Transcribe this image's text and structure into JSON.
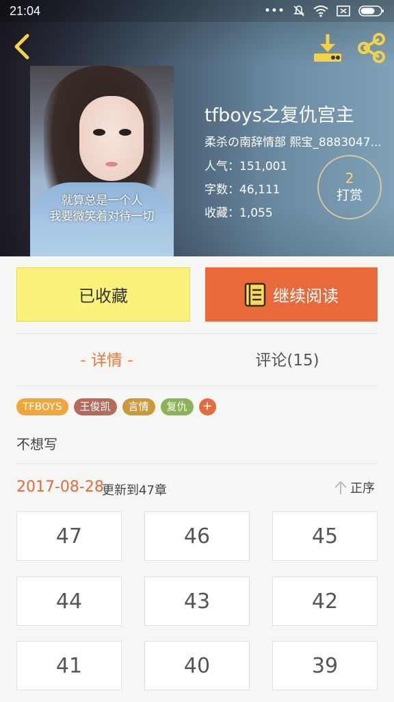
{
  "status_bar": {
    "time": "21:04",
    "dots": "•••"
  },
  "book": {
    "title": "tfboys之复仇宫主",
    "authors": "柔杀の南辞情部 熙宝_8883047...",
    "popularity": "人气：151,001",
    "word_count": "字数：46,111",
    "favorites": "收藏：1,055",
    "cover_caption_line1": "就算总是一个人",
    "cover_caption_line2": "我要微笑着对待一切"
  },
  "tip": {
    "count": "2",
    "label": "打赏"
  },
  "actions": {
    "collected_label": "已收藏",
    "continue_label": "继续阅读"
  },
  "tabs": {
    "detail": "- 详情 -",
    "comments": "评论(15)"
  },
  "tags": [
    {
      "label": "TFBOYS",
      "color": "#f0a63a"
    },
    {
      "label": "王俊凯",
      "color": "#b86a5a"
    },
    {
      "label": "言情",
      "color": "#c89a3a"
    },
    {
      "label": "复仇",
      "color": "#8cb25a"
    }
  ],
  "tag_add": "+",
  "intro": "不想写",
  "update": {
    "date": "2017-08-28",
    "text": "更新到47章",
    "sort_label": "正序"
  },
  "chapters": [
    "47",
    "46",
    "45",
    "44",
    "43",
    "42",
    "41",
    "40",
    "39"
  ],
  "colors": {
    "accent": "#e8693a",
    "collected_bg": "#fbf27c",
    "tip_gold": "#f2d77a"
  }
}
